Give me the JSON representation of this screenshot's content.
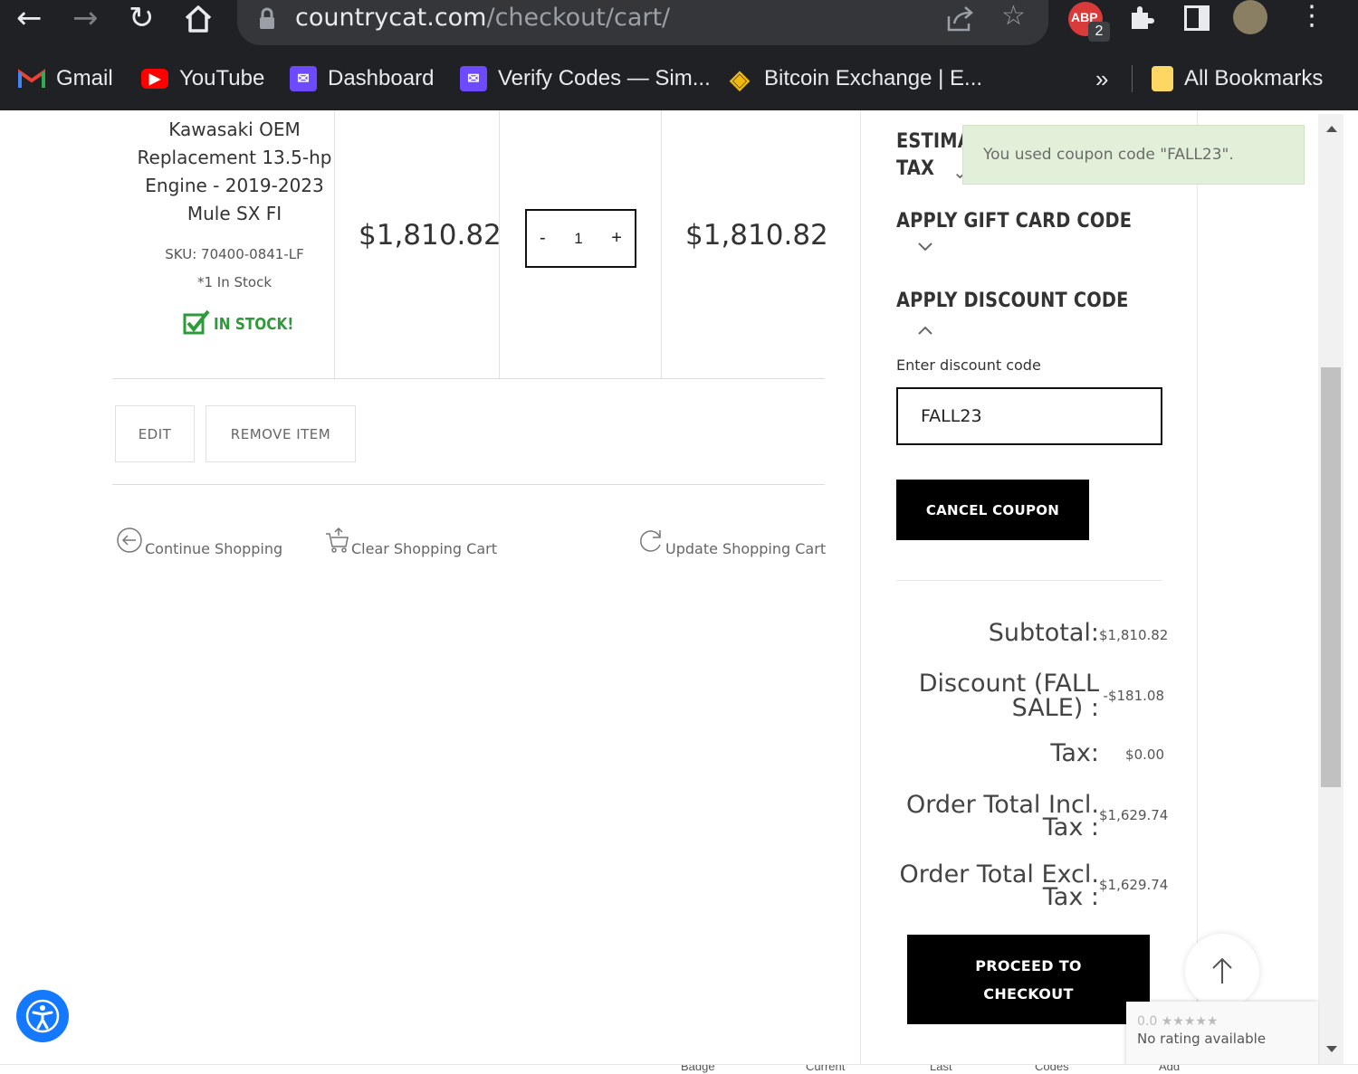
{
  "browser": {
    "url_host": "countrycat.com",
    "url_path": "/checkout/cart/",
    "extension_badge": "2",
    "bookmarks": [
      {
        "label": "Gmail",
        "icon": "gmail-icon",
        "color": "#ea4335"
      },
      {
        "label": "YouTube",
        "icon": "youtube-icon",
        "color": "#ff0000"
      },
      {
        "label": "Dashboard",
        "icon": "proton-icon",
        "color": "#6d4aff"
      },
      {
        "label": "Verify Codes — Sim...",
        "icon": "proton-icon",
        "color": "#6d4aff"
      },
      {
        "label": "Bitcoin Exchange | E...",
        "icon": "binance-icon",
        "color": "#f0b90b"
      }
    ],
    "overflow_label": "»",
    "all_bookmarks_label": "All Bookmarks"
  },
  "cart": {
    "item": {
      "name": "Kawasaki OEM Replacement 13.5-hp Engine - 2019-2023 Mule SX FI",
      "sku": "SKU: 70400-0841-LF",
      "stock_note": "*1 In Stock",
      "stock_badge": "IN STOCK!",
      "price": "$1,810.82",
      "quantity": "1",
      "qty_minus": "-",
      "qty_plus": "+",
      "subtotal": "$1,810.82"
    },
    "edit_label": "EDIT",
    "remove_label": "REMOVE ITEM",
    "continue_label": "Continue Shopping",
    "clear_label": "Clear Shopping Cart",
    "update_label": "Update Shopping Cart"
  },
  "sidebar": {
    "estimate_line1": "ESTIMA",
    "estimate_line2": "TAX",
    "notice": "You used coupon code \"FALL23\".",
    "gift_card_heading": "APPLY GIFT CARD CODE",
    "discount_heading": "APPLY DISCOUNT CODE",
    "discount_field_label": "Enter discount code",
    "discount_value": "FALL23",
    "cancel_coupon_label": "CANCEL COUPON",
    "totals": {
      "subtotal_label": "Subtotal:",
      "subtotal_value": "$1,810.82",
      "discount_label_1": "Discount (FALL",
      "discount_label_2": "SALE) :",
      "discount_value": "-$181.08",
      "tax_label": "Tax:",
      "tax_value": "$0.00",
      "incl_label_1": "Order Total Incl.",
      "incl_label_2": "Tax :",
      "incl_value": "$1,629.74",
      "excl_label_1": "Order Total Excl.",
      "excl_label_2": "Tax :",
      "excl_value": "$1,629.74"
    },
    "checkout_line1": "PROCEED TO",
    "checkout_line2": "CHECKOUT"
  },
  "recaptcha": {
    "rating": "0.0 ★★★★★",
    "text": "No rating available"
  },
  "footer_fragments": [
    "Badge",
    "Current",
    "Last",
    "Codes",
    "Add"
  ],
  "colors": {
    "chrome": "#202124",
    "notice_bg": "#e2efd9",
    "stock_green": "#2e9b3a",
    "button_black": "#000000",
    "accessibility_blue": "#1479ff"
  }
}
